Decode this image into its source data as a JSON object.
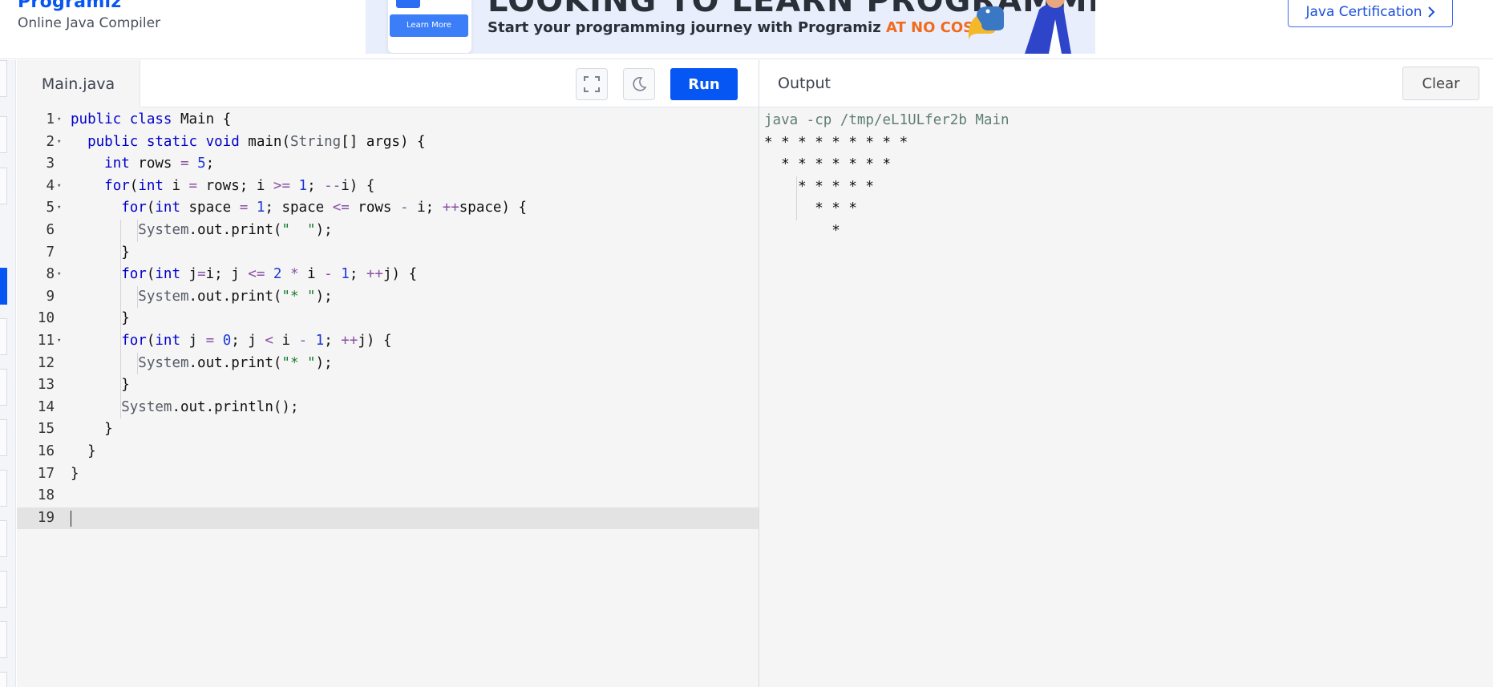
{
  "header": {
    "brand": "Programiz",
    "subtitle": "Online Java Compiler",
    "banner": {
      "headline": "LOOKING TO LEARN PROGRAMMING?",
      "tagline_prefix": "Start your programming journey with Programiz ",
      "tagline_accent": "AT NO COST",
      "tagline_suffix": ".",
      "learn_more": "Learn More"
    },
    "cert_button": "Java Certification",
    "cert_icon": "chevron-right-icon"
  },
  "editor": {
    "file_tab": "Main.java",
    "fullscreen_icon": "fullscreen-icon",
    "theme_icon": "moon-icon",
    "run_label": "Run",
    "current_line": 19,
    "lines": [
      {
        "n": "1",
        "fold": true,
        "html": "<span class='kw'>public</span> <span class='kw'>class</span> Main {"
      },
      {
        "n": "2",
        "fold": true,
        "html": "  <span class='kw'>public</span> <span class='kw'>static</span> <span class='kw'>void</span> main(<span class='ty'>String</span>[] args) {"
      },
      {
        "n": "3",
        "fold": false,
        "html": "    <span class='kw'>int</span> rows <span class='op'>=</span> <span class='num'>5</span>;"
      },
      {
        "n": "4",
        "fold": true,
        "html": "    <span class='kw'>for</span>(<span class='kw'>int</span> i <span class='op'>=</span> rows; i <span class='op'>&gt;=</span> <span class='num'>1</span>; <span class='op'>--</span>i) {"
      },
      {
        "n": "5",
        "fold": true,
        "html": "      <span class='kw'>for</span>(<span class='kw'>int</span> space <span class='op'>=</span> <span class='num'>1</span>; space <span class='op'>&lt;=</span> rows <span class='op'>-</span> i; <span class='op'>++</span>space) {"
      },
      {
        "n": "6",
        "fold": false,
        "html": "        <span class='ty'>System</span>.out.print(<span class='str'>\"  \"</span>);"
      },
      {
        "n": "7",
        "fold": false,
        "html": "      }"
      },
      {
        "n": "8",
        "fold": true,
        "html": "      <span class='kw'>for</span>(<span class='kw'>int</span> j<span class='op'>=</span>i; j <span class='op'>&lt;=</span> <span class='num'>2</span> <span class='op'>*</span> i <span class='op'>-</span> <span class='num'>1</span>; <span class='op'>++</span>j) {"
      },
      {
        "n": "9",
        "fold": false,
        "html": "        <span class='ty'>System</span>.out.print(<span class='str'>\"* \"</span>);"
      },
      {
        "n": "10",
        "fold": false,
        "html": "      }"
      },
      {
        "n": "11",
        "fold": true,
        "html": "      <span class='kw'>for</span>(<span class='kw'>int</span> j <span class='op'>=</span> <span class='num'>0</span>; j <span class='op'>&lt;</span> i <span class='op'>-</span> <span class='num'>1</span>; <span class='op'>++</span>j) {"
      },
      {
        "n": "12",
        "fold": false,
        "html": "        <span class='ty'>System</span>.out.print(<span class='str'>\"* \"</span>);"
      },
      {
        "n": "13",
        "fold": false,
        "html": "      }"
      },
      {
        "n": "14",
        "fold": false,
        "html": "      <span class='ty'>System</span>.out.println();"
      },
      {
        "n": "15",
        "fold": false,
        "html": "    }"
      },
      {
        "n": "16",
        "fold": false,
        "html": "  }"
      },
      {
        "n": "17",
        "fold": false,
        "html": "}"
      },
      {
        "n": "18",
        "fold": false,
        "html": ""
      },
      {
        "n": "19",
        "fold": false,
        "html": ""
      }
    ]
  },
  "output": {
    "title": "Output",
    "clear_label": "Clear",
    "command": "java -cp /tmp/eL1ULfer2b Main",
    "lines": [
      "* * * * * * * * * ",
      "  * * * * * * * ",
      "    * * * * * ",
      "      * * * ",
      "        * "
    ]
  },
  "colors": {
    "accent": "#0556f3",
    "keyword": "#0000cc",
    "type": "#555a66",
    "number": "#1d38d8",
    "string": "#1a7a2e",
    "operator": "#8a4fa6",
    "cost_accent": "#f06b1c"
  }
}
